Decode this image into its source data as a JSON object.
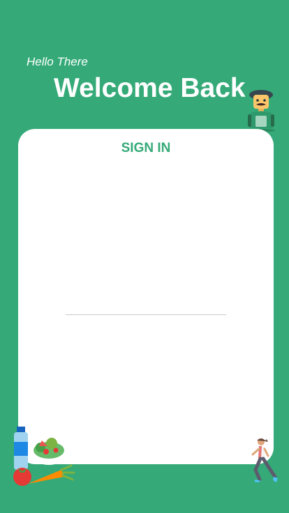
{
  "header": {
    "greeting": "Hello There",
    "title": "Welcome Back"
  },
  "card": {
    "tab_label": "SIGN IN"
  },
  "illustrations": {
    "chef": "chef-character-icon",
    "vegetables": "vegetables-and-bottle-icon",
    "runner": "running-woman-icon"
  },
  "colors": {
    "background": "#35aa78",
    "accent": "#35aa78",
    "card": "#ffffff"
  }
}
